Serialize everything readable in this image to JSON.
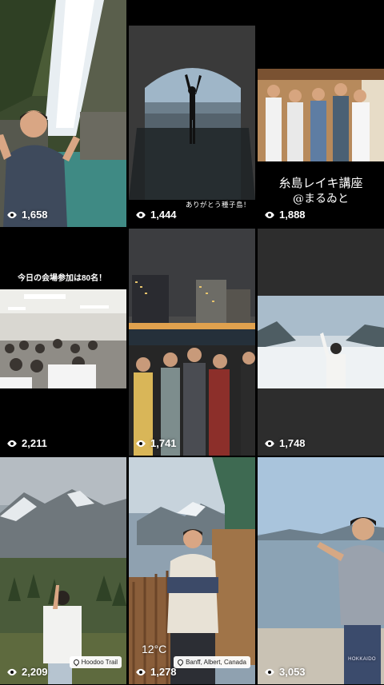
{
  "tiles": [
    {
      "views": "1,658"
    },
    {
      "views": "1,444",
      "caption": "ありがとう種子島！"
    },
    {
      "views": "1,888",
      "caption_line1": "糸島レイキ講座",
      "caption_line2": "@まるゐと"
    },
    {
      "views": "2,211",
      "caption": "今日の会場参加は80名！"
    },
    {
      "views": "1,741"
    },
    {
      "views": "1,748"
    },
    {
      "views": "2,209",
      "location": "Hoodoo Trail"
    },
    {
      "views": "1,278",
      "location": "Banff, Albert, Canada",
      "temperature": "12°C"
    },
    {
      "views": "3,053",
      "sticker": "HOKKAIDO"
    }
  ],
  "icons": {
    "views": "eye-icon",
    "location": "location-pin-icon"
  },
  "colors": {
    "background": "#000000",
    "text": "#ffffff"
  }
}
